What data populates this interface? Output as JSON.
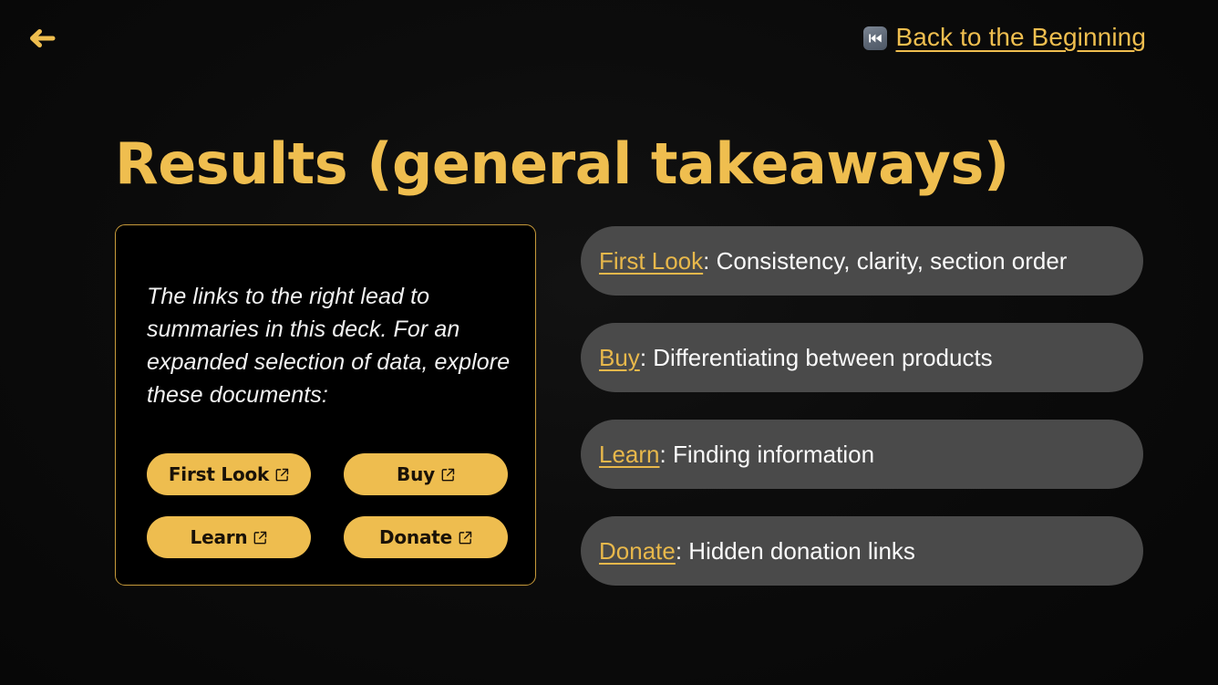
{
  "nav": {
    "back_arrow_icon": "arrow-left-icon",
    "beginning_link": {
      "icon": "rewind-emoji-icon",
      "label": "Back to the Beginning"
    }
  },
  "header": {
    "title": "Results (general takeaways)"
  },
  "info_card": {
    "paragraph": "The links to the right lead to summaries in this deck. For an expanded selection of data, explore these documents:",
    "buttons": [
      {
        "label": "First Look",
        "icon": "external-link-icon"
      },
      {
        "label": "Buy",
        "icon": "external-link-icon"
      },
      {
        "label": "Learn",
        "icon": "external-link-icon"
      },
      {
        "label": "Donate",
        "icon": "external-link-icon"
      }
    ]
  },
  "takeaways": [
    {
      "link": "First Look",
      "text": ": Consistency, clarity, section order"
    },
    {
      "link": "Buy",
      "text": ": Differentiating between products"
    },
    {
      "link": "Learn",
      "text": ": Finding information"
    },
    {
      "link": "Donate",
      "text": ": Hidden donation links"
    }
  ],
  "colors": {
    "accent": "#efbe4f",
    "background": "#0a0a0a",
    "pill": "#4a4a4a",
    "card_border": "#c79a3a",
    "text": "#fafafa"
  }
}
